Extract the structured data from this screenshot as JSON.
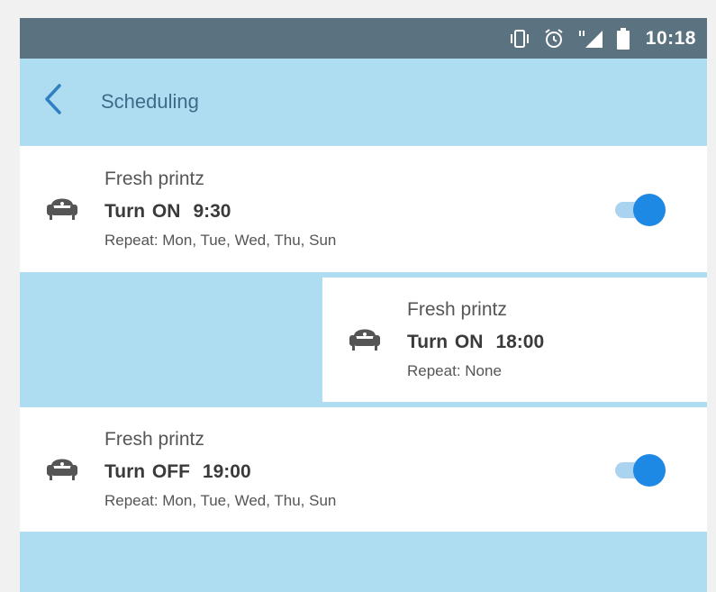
{
  "status_bar": {
    "time": "10:18",
    "icons": [
      "vibrate-icon",
      "alarm-icon",
      "signal-icon",
      "battery-icon"
    ]
  },
  "app_bar": {
    "title": "Scheduling",
    "back_icon": "back-arrow-icon"
  },
  "schedules": [
    {
      "device": "Fresh printz",
      "action": "Turn ON",
      "time": "9:30",
      "repeat": "Repeat: Mon, Tue, Wed, Thu, Sun",
      "enabled": true,
      "icon": "armchair-icon"
    },
    {
      "device": "Fresh printz",
      "action": "Turn ON",
      "time": "18:00",
      "repeat": "Repeat: None",
      "enabled": null,
      "icon": "armchair-icon",
      "swiped": true
    },
    {
      "device": "Fresh printz",
      "action": "Turn OFF",
      "time": "19:00",
      "repeat": "Repeat: Mon, Tue, Wed, Thu, Sun",
      "enabled": true,
      "icon": "armchair-icon"
    }
  ],
  "colors": {
    "status_bar": "#5b7380",
    "app_bar": "#aedcf0",
    "toggle_on": "#1e88e5",
    "title_text": "#3d6b8a"
  }
}
